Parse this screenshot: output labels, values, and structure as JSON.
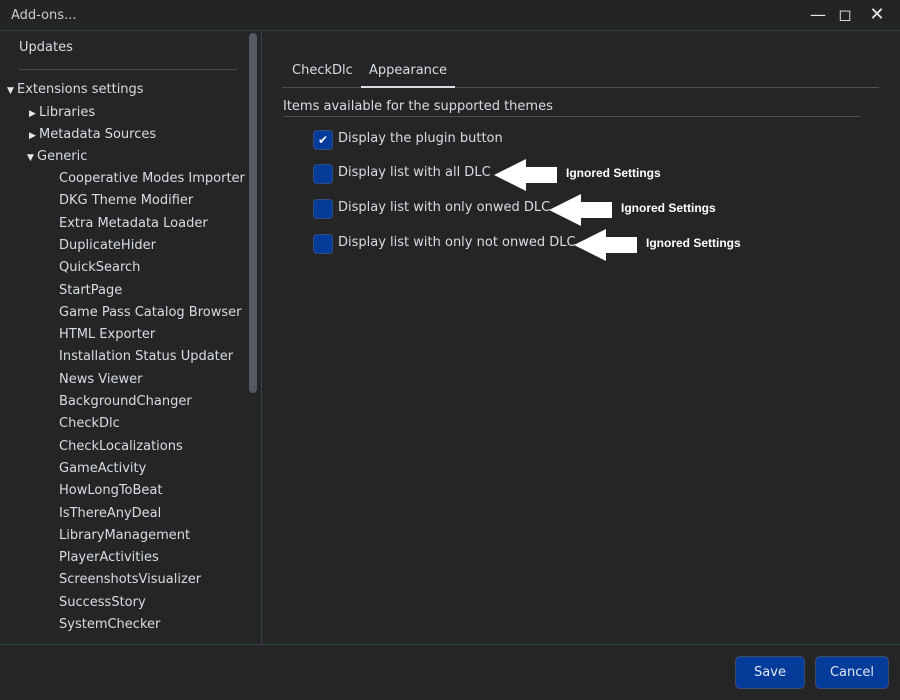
{
  "window": {
    "title": "Add-ons...",
    "minimize_icon": "minimize-icon",
    "maximize_icon": "maximize-icon",
    "close_icon": "close-icon"
  },
  "sidebar": {
    "updates": "Updates",
    "extensions": "Extensions settings",
    "libraries": "Libraries",
    "metadata": "Metadata Sources",
    "generic": "Generic",
    "generic_items": [
      "Cooperative Modes Importer",
      "DKG Theme Modifier",
      "Extra Metadata Loader",
      "DuplicateHider",
      "QuickSearch",
      "StartPage",
      "Game Pass Catalog Browser",
      "HTML Exporter",
      "Installation Status Updater",
      "News Viewer",
      "BackgroundChanger",
      "CheckDlc",
      "CheckLocalizations",
      "GameActivity",
      "HowLongToBeat",
      "IsThereAnyDeal",
      "LibraryManagement",
      "PlayerActivities",
      "ScreenshotsVisualizer",
      "SuccessStory",
      "SystemChecker"
    ]
  },
  "tabs": [
    {
      "label": "CheckDlc"
    },
    {
      "label": "Appearance",
      "active": true
    }
  ],
  "section_title": "Items available for the supported themes",
  "options": [
    {
      "label": "Display the plugin button",
      "checked": true
    },
    {
      "label": "Display list with all DLC",
      "checked": false,
      "annotation": "Ignored Settings"
    },
    {
      "label": "Display list with only onwed DLC",
      "checked": false,
      "annotation": "Ignored Settings"
    },
    {
      "label": "Display list with only not onwed DLC",
      "checked": false,
      "annotation": "Ignored Settings"
    }
  ],
  "footer": {
    "save": "Save",
    "cancel": "Cancel"
  },
  "colors": {
    "background": "#252525",
    "accent": "#053c9a",
    "annotation": "#ffffff"
  }
}
